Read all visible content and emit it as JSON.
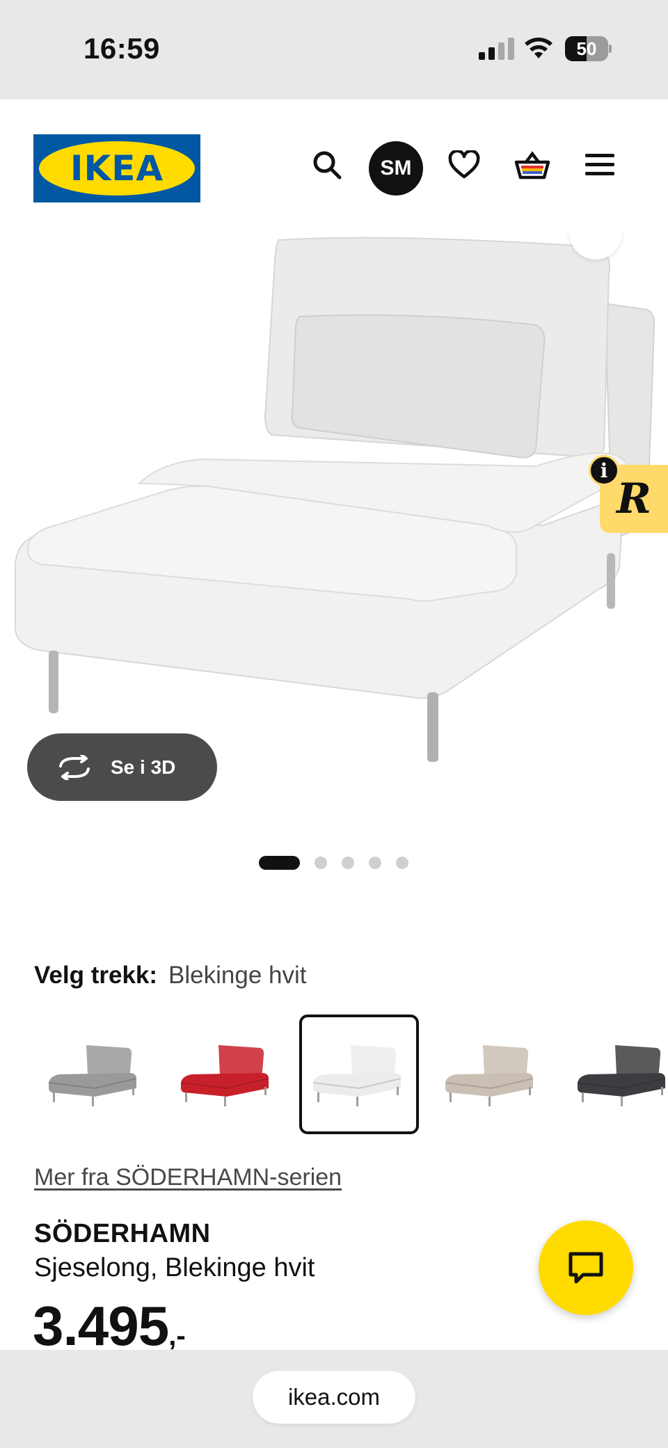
{
  "status_bar": {
    "time": "16:59",
    "battery_percent": "50",
    "battery_level": 0.5,
    "signal_bars": 2
  },
  "header": {
    "logo_text": "IKEA",
    "user_initials": "SM",
    "icons": [
      "search-icon",
      "heart-icon",
      "basket-icon",
      "menu-icon"
    ]
  },
  "gallery": {
    "view_3d_label": "Se i 3D",
    "slide_count": 5,
    "active_slide": 1,
    "widget_letter": "R",
    "widget_info": "i"
  },
  "cover": {
    "label": "Velg trekk:",
    "selected_value": "Blekinge hvit",
    "swatches": [
      {
        "color": "#9a9a9a",
        "selected": false
      },
      {
        "color": "#c8202a",
        "selected": false
      },
      {
        "color": "#ececea",
        "selected": true
      },
      {
        "color": "#c9c0b3",
        "selected": false
      },
      {
        "color": "#3c3d40",
        "selected": false
      }
    ]
  },
  "product": {
    "series_link": "Mer fra SÖDERHAMN-serien",
    "name": "SÖDERHAMN",
    "description": "Sjeselong, Blekinge hvit",
    "price": "3.495",
    "price_suffix": ",-"
  },
  "browser": {
    "url": "ikea.com"
  },
  "colors": {
    "ikea_blue": "#0058a3",
    "ikea_yellow": "#ffdb00",
    "widget_yellow": "#ffd96a"
  }
}
